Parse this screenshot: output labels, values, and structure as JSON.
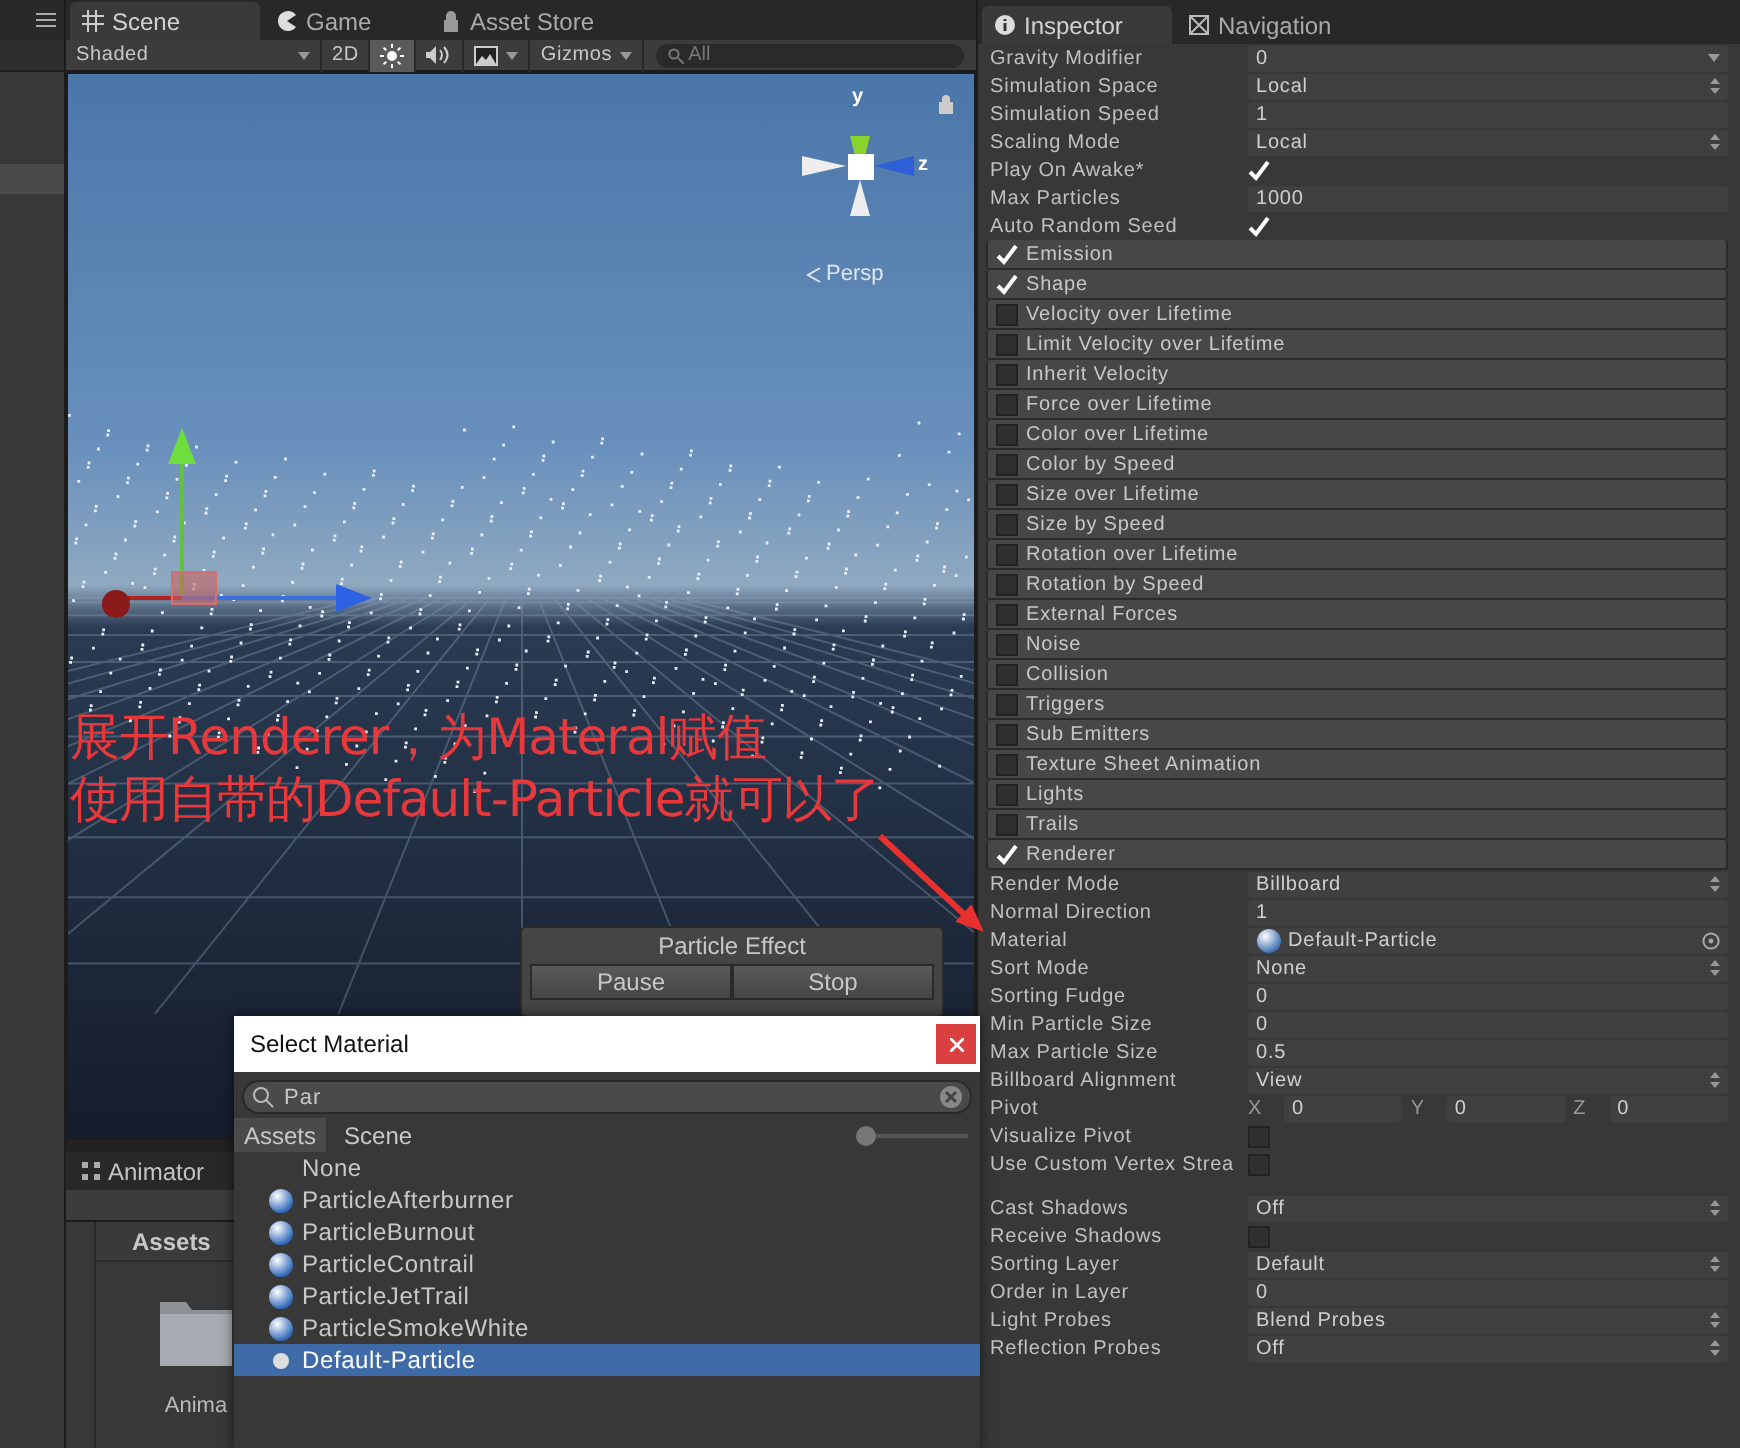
{
  "scene_view": {
    "tabs": [
      {
        "label": "Scene",
        "selected": true
      },
      {
        "label": "Game",
        "selected": false
      },
      {
        "label": "Asset Store",
        "selected": false
      }
    ],
    "toolbar": {
      "shading": "Shaded",
      "mode_2d": "2D",
      "lighting_on": true,
      "audio_on": false,
      "effects_on": false,
      "gizmos": "Gizmos",
      "search": {
        "placeholder": "All"
      }
    },
    "orientation": {
      "axes": [
        "y",
        "z"
      ],
      "projection": "Persp"
    },
    "particle_effect": {
      "title": "Particle Effect",
      "buttons": [
        "Pause",
        "Stop"
      ]
    },
    "annotation": {
      "lines": [
        "展开Renderer，为Materal赋值",
        "使用自带的Default-Particle就可以了"
      ]
    }
  },
  "animator_tab": {
    "label": "Animator"
  },
  "project": {
    "heading": "Assets",
    "items": [
      {
        "label": "Anima"
      }
    ]
  },
  "select_material": {
    "title": "Select Material",
    "search": "Par",
    "tabs": [
      {
        "label": "Assets",
        "selected": true
      },
      {
        "label": "Scene",
        "selected": false
      }
    ],
    "zoom": {
      "level": 0
    },
    "items": [
      {
        "label": "None",
        "kind": "none",
        "selected": false
      },
      {
        "label": "ParticleAfterburner",
        "kind": "material",
        "selected": false
      },
      {
        "label": "ParticleBurnout",
        "kind": "material",
        "selected": false
      },
      {
        "label": "ParticleContrail",
        "kind": "material",
        "selected": false
      },
      {
        "label": "ParticleJetTrail",
        "kind": "material",
        "selected": false
      },
      {
        "label": "ParticleSmokeWhite",
        "kind": "material",
        "selected": false
      },
      {
        "label": "Default-Particle",
        "kind": "builtin",
        "selected": true
      }
    ]
  },
  "inspector": {
    "tabs": [
      {
        "label": "Inspector",
        "selected": true
      },
      {
        "label": "Navigation",
        "selected": false
      }
    ],
    "properties": [
      {
        "label": "Gravity Modifier",
        "kind": "curve",
        "value": "0"
      },
      {
        "label": "Simulation Space",
        "kind": "dropdown",
        "value": "Local"
      },
      {
        "label": "Simulation Speed",
        "kind": "field",
        "value": "1"
      },
      {
        "label": "Scaling Mode",
        "kind": "dropdown",
        "value": "Local"
      },
      {
        "label": "Play On Awake*",
        "kind": "checkbox",
        "checked": true
      },
      {
        "label": "Max Particles",
        "kind": "field",
        "value": "1000"
      },
      {
        "label": "Auto Random Seed",
        "kind": "checkbox",
        "checked": true
      }
    ],
    "modules": [
      {
        "label": "Emission",
        "checked": true
      },
      {
        "label": "Shape",
        "checked": true
      },
      {
        "label": "Velocity over Lifetime",
        "checked": false
      },
      {
        "label": "Limit Velocity over Lifetime",
        "checked": false
      },
      {
        "label": "Inherit Velocity",
        "checked": false
      },
      {
        "label": "Force over Lifetime",
        "checked": false
      },
      {
        "label": "Color over Lifetime",
        "checked": false
      },
      {
        "label": "Color by Speed",
        "checked": false
      },
      {
        "label": "Size over Lifetime",
        "checked": false
      },
      {
        "label": "Size by Speed",
        "checked": false
      },
      {
        "label": "Rotation over Lifetime",
        "checked": false
      },
      {
        "label": "Rotation by Speed",
        "checked": false
      },
      {
        "label": "External Forces",
        "checked": false
      },
      {
        "label": "Noise",
        "checked": false
      },
      {
        "label": "Collision",
        "checked": false
      },
      {
        "label": "Triggers",
        "checked": false
      },
      {
        "label": "Sub Emitters",
        "checked": false
      },
      {
        "label": "Texture Sheet Animation",
        "checked": false
      },
      {
        "label": "Lights",
        "checked": false
      },
      {
        "label": "Trails",
        "checked": false
      },
      {
        "label": "Renderer",
        "checked": true
      }
    ],
    "renderer_properties": [
      {
        "label": "Render Mode",
        "kind": "dropdown",
        "value": "Billboard"
      },
      {
        "label": "Normal Direction",
        "kind": "field",
        "value": "1"
      },
      {
        "label": "Material",
        "kind": "object",
        "value": "Default-Particle"
      },
      {
        "label": "Sort Mode",
        "kind": "dropdown",
        "value": "None"
      },
      {
        "label": "Sorting Fudge",
        "kind": "field",
        "value": "0"
      },
      {
        "label": "Min Particle Size",
        "kind": "field",
        "value": "0"
      },
      {
        "label": "Max Particle Size",
        "kind": "field",
        "value": "0.5"
      },
      {
        "label": "Billboard Alignment",
        "kind": "dropdown",
        "value": "View"
      },
      {
        "label": "Pivot",
        "kind": "vector",
        "components": [
          {
            "axis": "X",
            "value": "0"
          },
          {
            "axis": "Y",
            "value": "0"
          },
          {
            "axis": "Z",
            "value": "0"
          }
        ]
      },
      {
        "label": "Visualize Pivot",
        "kind": "checkbox",
        "checked": false
      },
      {
        "label": "Use Custom Vertex Strea",
        "kind": "checkbox",
        "checked": false
      },
      {
        "kind": "gap"
      },
      {
        "label": "Cast Shadows",
        "kind": "dropdown",
        "value": "Off"
      },
      {
        "label": "Receive Shadows",
        "kind": "checkbox",
        "checked": false
      },
      {
        "label": "Sorting Layer",
        "kind": "dropdown",
        "value": "Default"
      },
      {
        "label": "Order in Layer",
        "kind": "field",
        "value": "0"
      },
      {
        "label": "Light Probes",
        "kind": "dropdown",
        "value": "Blend Probes"
      },
      {
        "label": "Reflection Probes",
        "kind": "dropdown",
        "value": "Off"
      }
    ]
  }
}
